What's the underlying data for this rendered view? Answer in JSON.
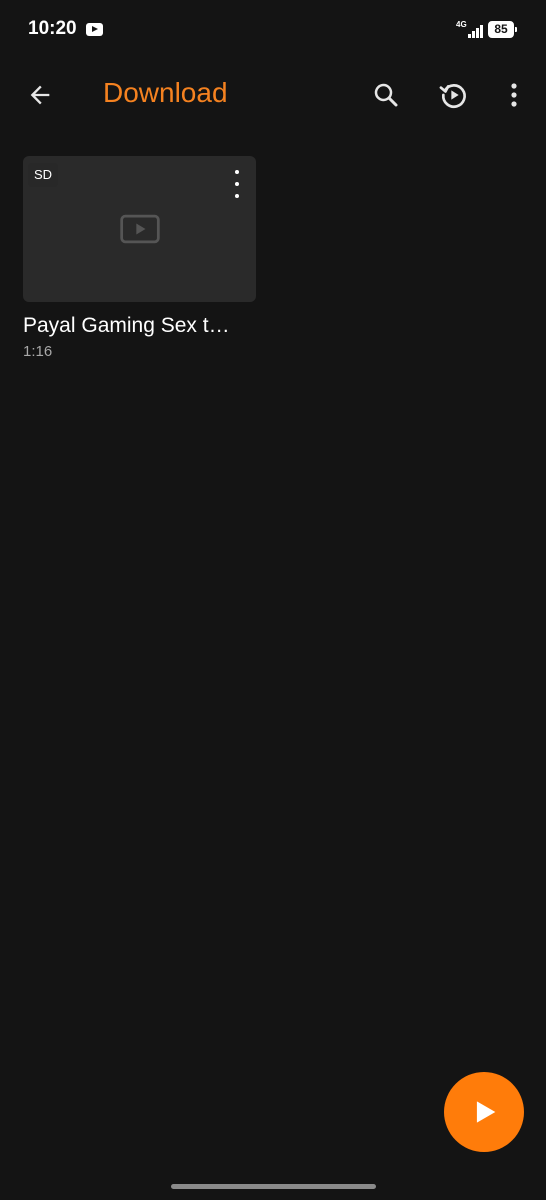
{
  "status_bar": {
    "time": "10:20",
    "network": "4G",
    "battery": "85",
    "notification_icon": "youtube-icon"
  },
  "app_bar": {
    "title": "Download",
    "title_color": "#f58220",
    "back_icon": "arrow-left-icon",
    "search_icon": "search-icon",
    "history_icon": "history-play-icon",
    "more_icon": "more-vertical-icon"
  },
  "videos": [
    {
      "quality_badge": "SD",
      "title": "Payal Gaming Sex t…",
      "duration": "1:16"
    }
  ],
  "fab": {
    "icon": "play-icon",
    "color": "#ff7c0a"
  }
}
